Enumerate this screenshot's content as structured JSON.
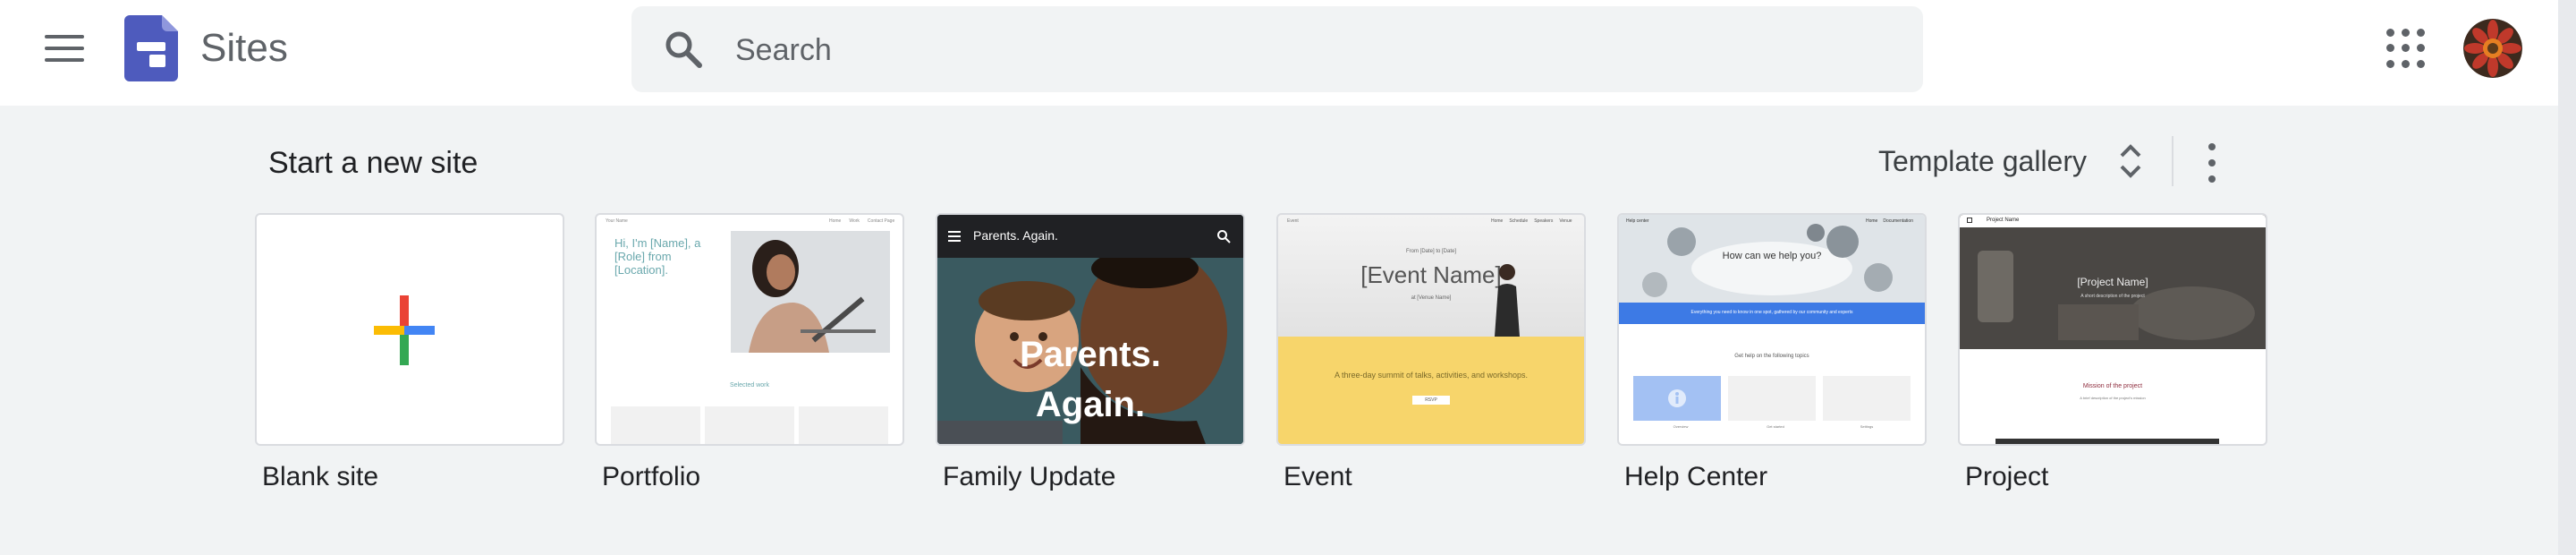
{
  "header": {
    "app_name": "Sites",
    "search": {
      "placeholder": "Search",
      "value": ""
    },
    "icons": [
      "menu-icon",
      "sites-logo",
      "search-icon",
      "google-apps-icon",
      "account-avatar"
    ]
  },
  "start_section": {
    "title": "Start a new site",
    "gallery_label": "Template gallery",
    "templates": [
      {
        "name": "Blank site"
      },
      {
        "name": "Portfolio",
        "preview": {
          "nav_brand": "Your Name",
          "nav_links": [
            "Home",
            "Work",
            "Contact Page"
          ],
          "intro": [
            "Hi, I'm [Name], a",
            "[Role] from",
            "[Location]."
          ],
          "section_label": "Selected work"
        }
      },
      {
        "name": "Family Update",
        "preview": {
          "bar_title": "Parents. Again.",
          "overlay_lines": [
            "Parents.",
            "Again."
          ]
        }
      },
      {
        "name": "Event",
        "preview": {
          "brand": "Event",
          "nav_links": [
            "Home",
            "Schedule",
            "Speakers",
            "Venue"
          ],
          "date_line": "From [Date] to [Date]",
          "heading": "[Event Name]",
          "venue_line": "at [Venue Name]",
          "tagline": "A three-day summit of talks, activities, and workshops.",
          "button": "RSVP"
        }
      },
      {
        "name": "Help Center",
        "preview": {
          "brand": "Help center",
          "nav_links": [
            "Home",
            "Documentation"
          ],
          "question": "How can we help you?",
          "banner": "Everything you need to know in one spot, gathered by our community and experts",
          "topics_title": "Get help on the following topics",
          "topics": [
            "Overview",
            "Get started",
            "Settings"
          ]
        }
      },
      {
        "name": "Project",
        "preview": {
          "brand": "Project Name",
          "heading": "[Project Name]",
          "subline": "A short description of the project",
          "mission_title": "Mission of the project",
          "mission_line": "A brief description of the project's mission"
        }
      }
    ]
  },
  "colors": {
    "header_bg": "#ffffff",
    "page_bg": "#f1f3f4",
    "sites_brand": "#4e5bbd",
    "text_primary": "#202124",
    "icon_grey": "#5f6368",
    "event_yellow": "#f7d56b",
    "help_blue": "#3d7ae5"
  }
}
